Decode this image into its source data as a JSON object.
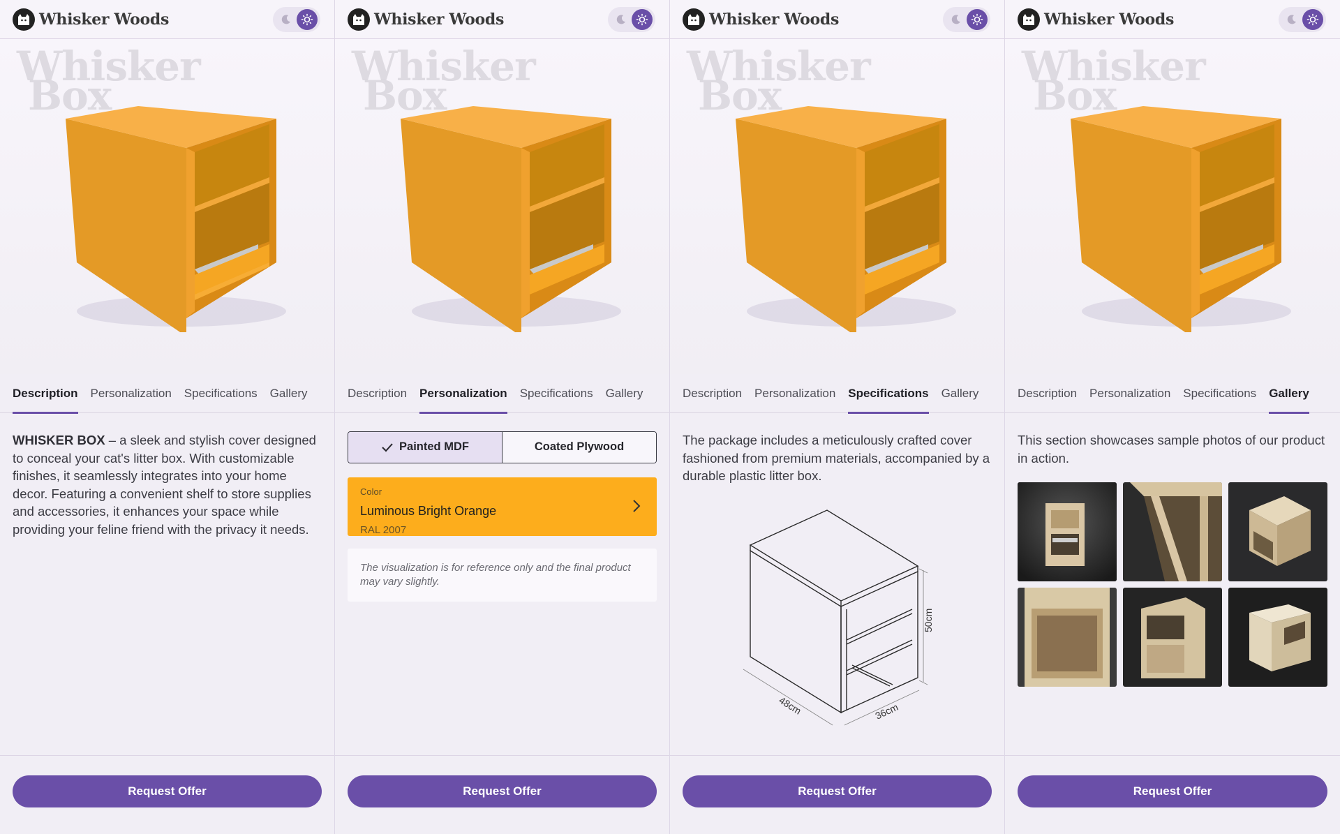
{
  "brand": {
    "name": "Whisker Woods"
  },
  "hero": {
    "watermark_line1": "Whisker",
    "watermark_line2": "Box"
  },
  "tabs": [
    "Description",
    "Personalization",
    "Specifications",
    "Gallery"
  ],
  "description": {
    "product_name": "WHISKER BOX",
    "text": " – a sleek and stylish cover designed to conceal your cat's litter box. With customizable finishes, it seamlessly integrates into your home decor. Featuring a convenient shelf to store supplies and accessories, it enhances your space while providing your feline friend with the privacy it needs."
  },
  "personalization": {
    "materials": [
      "Painted MDF",
      "Coated Plywood"
    ],
    "selected_material": "Painted MDF",
    "color_caption": "Color",
    "color_name": "Luminous Bright Orange",
    "color_code": "RAL 2007",
    "color_hex": "#fdad1c",
    "notice": "The visualization is for reference only and the final product may vary slightly."
  },
  "specifications": {
    "text": "The package includes a meticulously crafted cover fashioned from premium materials, accompanied by a durable plastic litter box.",
    "dim_height": "50cm",
    "dim_width": "48cm",
    "dim_depth": "36cm"
  },
  "gallery": {
    "text": "This section showcases sample photos of our product in action."
  },
  "cta": {
    "label": "Request Offer"
  },
  "colors": {
    "accent": "#6a4fa8",
    "product_orange": "#f5a623",
    "background": "#f1eef5"
  }
}
